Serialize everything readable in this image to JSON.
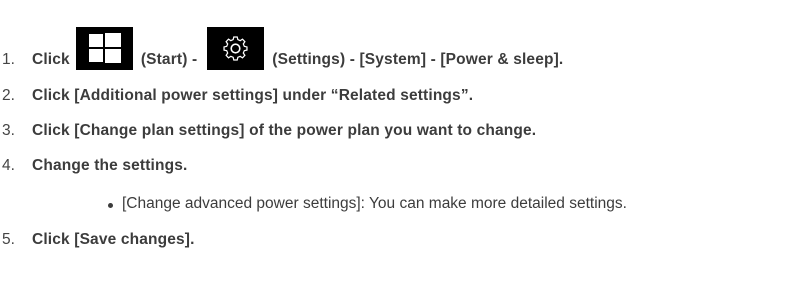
{
  "steps": [
    {
      "number": "1.",
      "parts": {
        "a": "Click",
        "start_label": "(Start) -",
        "settings_label": "(Settings) - [System] - [Power & sleep]."
      }
    },
    {
      "number": "2.",
      "text": "Click [Additional power settings] under “Related settings”."
    },
    {
      "number": "3.",
      "text": "Click [Change plan settings] of the power plan you want to change."
    },
    {
      "number": "4.",
      "text": "Change the settings."
    },
    {
      "number": "5.",
      "text": "Click [Save changes]."
    }
  ],
  "sub_bullet": "[Change advanced power settings]: You can make more detailed settings.",
  "icons": {
    "start": "windows-start-icon",
    "settings": "gear-settings-icon"
  },
  "colors": {
    "text": "#3c3c3c",
    "icon_bg": "#000000",
    "icon_fg": "#ffffff"
  }
}
